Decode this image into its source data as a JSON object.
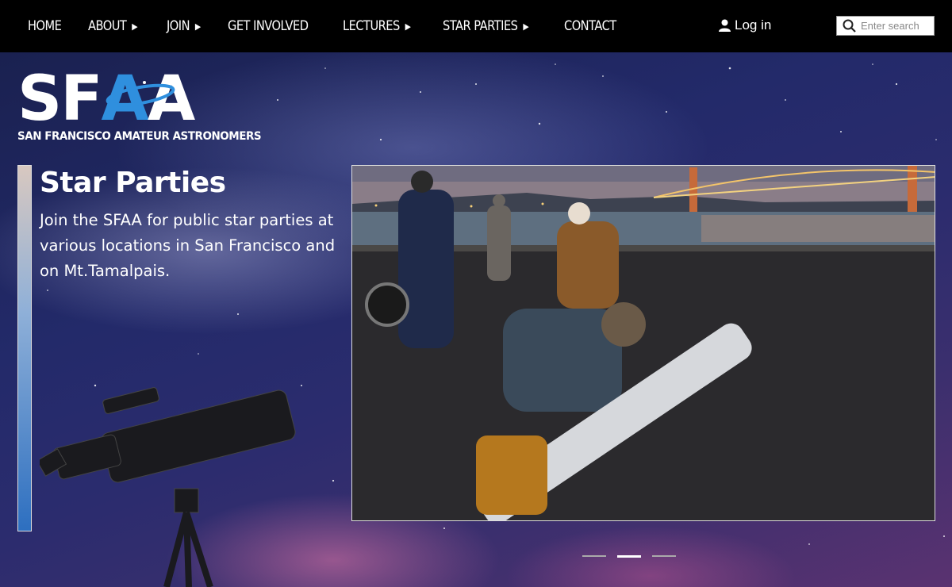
{
  "nav": {
    "items": [
      {
        "label": "HOME",
        "caret": ""
      },
      {
        "label": "ABOUT",
        "caret": "▶"
      },
      {
        "label": "JOIN",
        "caret": "▶"
      },
      {
        "label": "GET INVOLVED",
        "caret": ""
      },
      {
        "label": "LECTURES",
        "caret": "▶"
      },
      {
        "label": "STAR PARTIES",
        "caret": "▶"
      },
      {
        "label": "CONTACT",
        "caret": ""
      }
    ],
    "login_label": "Log in",
    "login_icon": "user-icon",
    "search_placeholder": "Enter search",
    "search_icon": "search-icon"
  },
  "logo": {
    "letters": [
      "S",
      "F",
      "A",
      "A"
    ],
    "subtitle": "SAN FRANCISCO AMATEUR ASTRONOMERS",
    "accent_color": "#2f8fde"
  },
  "slide": {
    "title": "Star Parties",
    "text": "Join the SFAA for public star parties at various locations in San Francisco and on Mt.Tamalpais.",
    "photo_alt": "Star party at dusk near the Golden Gate Bridge with a telescope",
    "current": 2,
    "total": 3
  },
  "colors": {
    "topbar": "#000000",
    "text": "#ffffff"
  }
}
